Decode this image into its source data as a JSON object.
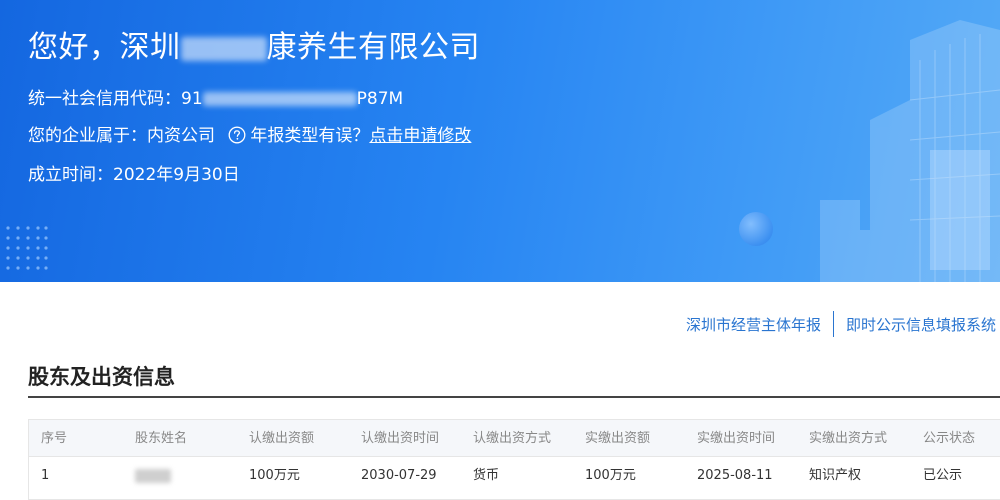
{
  "banner": {
    "greeting_prefix": "您好，深圳",
    "greeting_suffix": "康养生有限公司",
    "credit_label": "统一社会信用代码：",
    "credit_prefix": "91",
    "credit_suffix": "P87M",
    "type_label": "您的企业属于：",
    "type_value": "内资公司",
    "type_question": "年报类型有误？",
    "type_link": "点击申请修改",
    "established_label": "成立时间：",
    "established_value": "2022年9月30日",
    "colors": {
      "gradient_start": "#1467e0",
      "gradient_end": "#55aaf6"
    }
  },
  "quick_links": [
    {
      "label": "深圳市经营主体年报"
    },
    {
      "label": "即时公示信息填报系统"
    }
  ],
  "section": {
    "title": "股东及出资信息"
  },
  "table": {
    "headers": [
      "序号",
      "股东姓名",
      "认缴出资额",
      "认缴出资时间",
      "认缴出资方式",
      "实缴出资额",
      "实缴出资时间",
      "实缴出资方式",
      "公示状态"
    ],
    "rows": [
      {
        "index": "1",
        "subscribed_amount": "100万元",
        "subscribed_date": "2030-07-29",
        "subscribed_method": "货币",
        "paid_amount": "100万元",
        "paid_date": "2025-08-11",
        "paid_method": "知识产权",
        "status": "已公示"
      }
    ]
  },
  "icons": {
    "help": "question-circle-icon",
    "accent_color": "#2a75d0"
  }
}
